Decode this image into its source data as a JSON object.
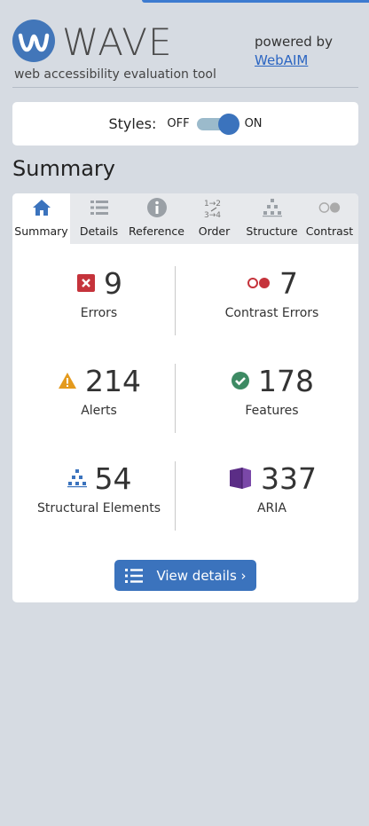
{
  "header": {
    "logo_word": "WAVE",
    "tagline": "web accessibility evaluation tool",
    "powered_by": "powered by",
    "link": "WebAIM"
  },
  "styles": {
    "label": "Styles:",
    "off": "OFF",
    "on": "ON",
    "state": "on"
  },
  "summary_title": "Summary",
  "tabs": [
    {
      "label": "Summary",
      "icon": "home-icon",
      "active": true
    },
    {
      "label": "Details",
      "icon": "list-icon",
      "active": false
    },
    {
      "label": "Reference",
      "icon": "info-icon",
      "active": false
    },
    {
      "label": "Order",
      "icon": "order-icon",
      "active": false
    },
    {
      "label": "Structure",
      "icon": "structure-icon",
      "active": false
    },
    {
      "label": "Contrast",
      "icon": "contrast-icon",
      "active": false
    }
  ],
  "stats": {
    "errors": {
      "value": "9",
      "label": "Errors"
    },
    "contrast_errors": {
      "value": "7",
      "label": "Contrast Errors"
    },
    "alerts": {
      "value": "214",
      "label": "Alerts"
    },
    "features": {
      "value": "178",
      "label": "Features"
    },
    "structural": {
      "value": "54",
      "label": "Structural Elements"
    },
    "aria": {
      "value": "337",
      "label": "ARIA"
    }
  },
  "view_details": "View details ›",
  "colors": {
    "accent": "#3b73bd",
    "error": "#c5333b",
    "alert": "#e49a1d",
    "feature": "#3d8a63",
    "aria": "#5b2d86"
  }
}
